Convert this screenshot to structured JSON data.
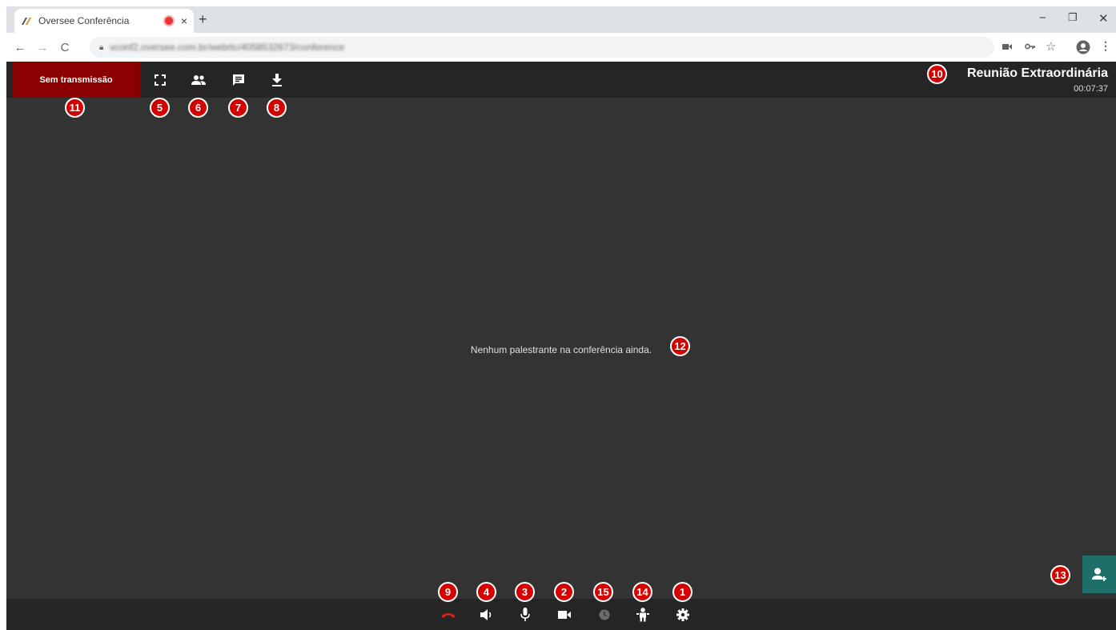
{
  "browser": {
    "tab_title": "Oversee Conferência",
    "tab_close": "×",
    "new_tab": "+",
    "url": "vconf2.oversee.com.br/webrtc/4058532673/conference",
    "window_controls": {
      "minimize": "−",
      "restore": "❐",
      "close": "✕"
    }
  },
  "toolbar": {
    "transmission_label": "Sem transmissão",
    "icons": [
      "fullscreen-icon",
      "participants-icon",
      "chat-icon",
      "download-icon"
    ]
  },
  "meeting": {
    "title": "Reunião Extraordinária",
    "elapsed": "00:07:37"
  },
  "main": {
    "empty_message": "Nenhum palestrante na conferência ainda."
  },
  "controls": {
    "icons": [
      "hangup-icon",
      "speaker-icon",
      "microphone-icon",
      "camera-icon",
      "clock-icon",
      "presenter-icon",
      "settings-icon"
    ],
    "hangup_color": "#e02020"
  },
  "badges": {
    "b1": "1",
    "b2": "2",
    "b3": "3",
    "b4": "4",
    "b5": "5",
    "b6": "6",
    "b7": "7",
    "b8": "8",
    "b9": "9",
    "b10": "10",
    "b11": "11",
    "b12": "12",
    "b13": "13",
    "b14": "14",
    "b15": "15"
  },
  "colors": {
    "transmission_bg": "#8b0000",
    "app_bg": "#333333",
    "bar_bg": "#252525",
    "invite_bg": "#1e6e6a",
    "badge_bg": "#d40000"
  }
}
